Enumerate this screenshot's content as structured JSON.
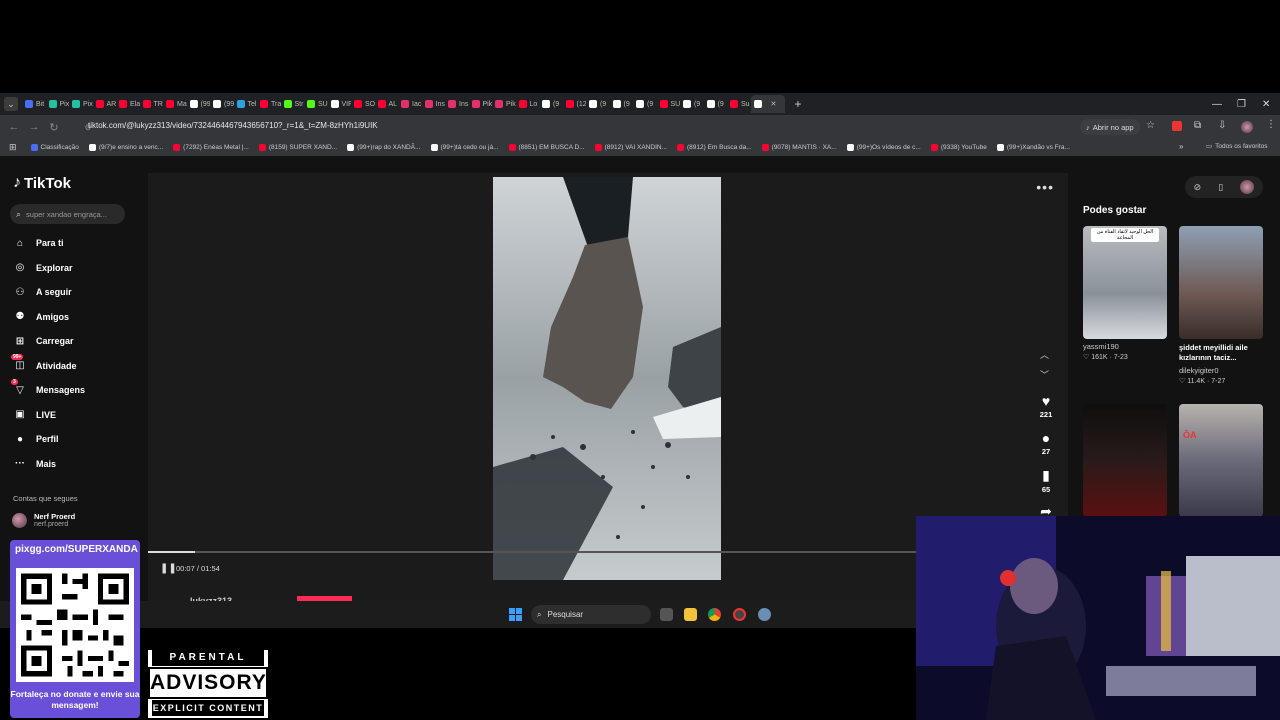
{
  "browser": {
    "tabs": [
      "Bit",
      "Pix",
      "Pix",
      "AR",
      "Ela",
      "TR",
      "Ma",
      "(99",
      "(99",
      "Tel",
      "Tra",
      "Str",
      "SU",
      "VIF",
      "SO",
      "AL",
      "Iac",
      "Ins",
      "Ins",
      "Pik",
      "Pik",
      "Lo",
      "(9",
      "(12",
      "(9",
      "(9",
      "(9",
      "SU",
      "(9",
      "(9",
      "Su",
      ""
    ],
    "tab_colors": [
      "#4a6cf7",
      "#22c1a0",
      "#22c1a0",
      "#ff0033",
      "#ff0033",
      "#ff0033",
      "#ff0033",
      "#fff",
      "#fff",
      "#2aa3e0",
      "#ff0033",
      "#53fc18",
      "#53fc18",
      "#fff",
      "#ff0033",
      "#ff0033",
      "#e1306c",
      "#e1306c",
      "#e1306c",
      "#e1306c",
      "#e1306c",
      "#ff0033",
      "#fff",
      "#ff0033",
      "#fff",
      "#fff",
      "#fff",
      "#ff0033",
      "#fff",
      "#fff",
      "#ff0033",
      "#fff"
    ],
    "url": "tiktok.com/@lukyzz313/video/7324464467943656710?_r=1&_t=ZM-8zHYh1i9UIK",
    "open_app": "Abrir no app",
    "bookmarks": [
      "Classificação",
      "(9/7)e ensino a venc...",
      "(7292) Enéas Metal |...",
      "(8159) SUPER XAND...",
      "(99+)rap do XANDÃ...",
      "(99+)tá cedo ou já...",
      "(8851) EM BUSCA D...",
      "(8912) VAI XANDIN...",
      "(8912) Em Busca da...",
      "(9078) MANTIS · XA...",
      "(99+)Os vídeos de c...",
      "(9338) YouTube",
      "(99+)Xandão vs Fra..."
    ],
    "bookmark_colors": [
      "#4a6cf7",
      "#fff",
      "#ff0033",
      "#ff0033",
      "#fff",
      "#fff",
      "#ff0033",
      "#ff0033",
      "#ff0033",
      "#ff0033",
      "#fff",
      "#ff0033",
      "#fff"
    ],
    "all_favorites": "Todos os favoritos"
  },
  "tiktok": {
    "logo": "TikTok",
    "search_placeholder": "super xandao engraça...",
    "nav": [
      {
        "label": "Para ti",
        "icon": "⌂"
      },
      {
        "label": "Explorar",
        "icon": "◎"
      },
      {
        "label": "A seguir",
        "icon": "⚇"
      },
      {
        "label": "Amigos",
        "icon": "⚉"
      },
      {
        "label": "Carregar",
        "icon": "⊞"
      },
      {
        "label": "Atividade",
        "icon": "◫",
        "badge": "99+"
      },
      {
        "label": "Mensagens",
        "icon": "▽",
        "badge": "3"
      },
      {
        "label": "LIVE",
        "icon": "▣"
      },
      {
        "label": "Perfil",
        "icon": "●"
      },
      {
        "label": "Mais",
        "icon": "···"
      }
    ],
    "following_title": "Contas que segues",
    "following_account": {
      "name": "Nerf Proerd",
      "handle": "nerf.proerd"
    },
    "player": {
      "time": "00:07 / 01:54",
      "progress": 0.061,
      "author": "lukyzz313",
      "likes": "221",
      "comments": "27",
      "saves": "65"
    },
    "suggested_title": "Podes gostar",
    "cards": [
      {
        "title": "",
        "user": "yassmi190",
        "meta": "♡ 161K · 7-23",
        "thumb_text": "الحل الوحيد لاتقاد الفتاة من المجاعة"
      },
      {
        "title": "şiddet meyillidi aile kızlarının taciz...",
        "user": "dilekyigiter0",
        "meta": "♡ 11.4K · 7-27",
        "thumb_text": ""
      },
      {
        "title": "",
        "user": "",
        "meta": "",
        "thumb_text": ""
      },
      {
        "title": "",
        "user": "",
        "meta": "",
        "thumb_text": "ŌA"
      }
    ]
  },
  "taskbar": {
    "search_label": "Pesquisar"
  },
  "overlay": {
    "qr_url": "pixgg.com/SUPERXANDA",
    "donate": "Fortaleça no donate e envie sua mensagem!",
    "advisory": {
      "line1": "PARENTAL",
      "line2": "ADVISORY",
      "line3": "EXPLICIT CONTENT"
    }
  }
}
